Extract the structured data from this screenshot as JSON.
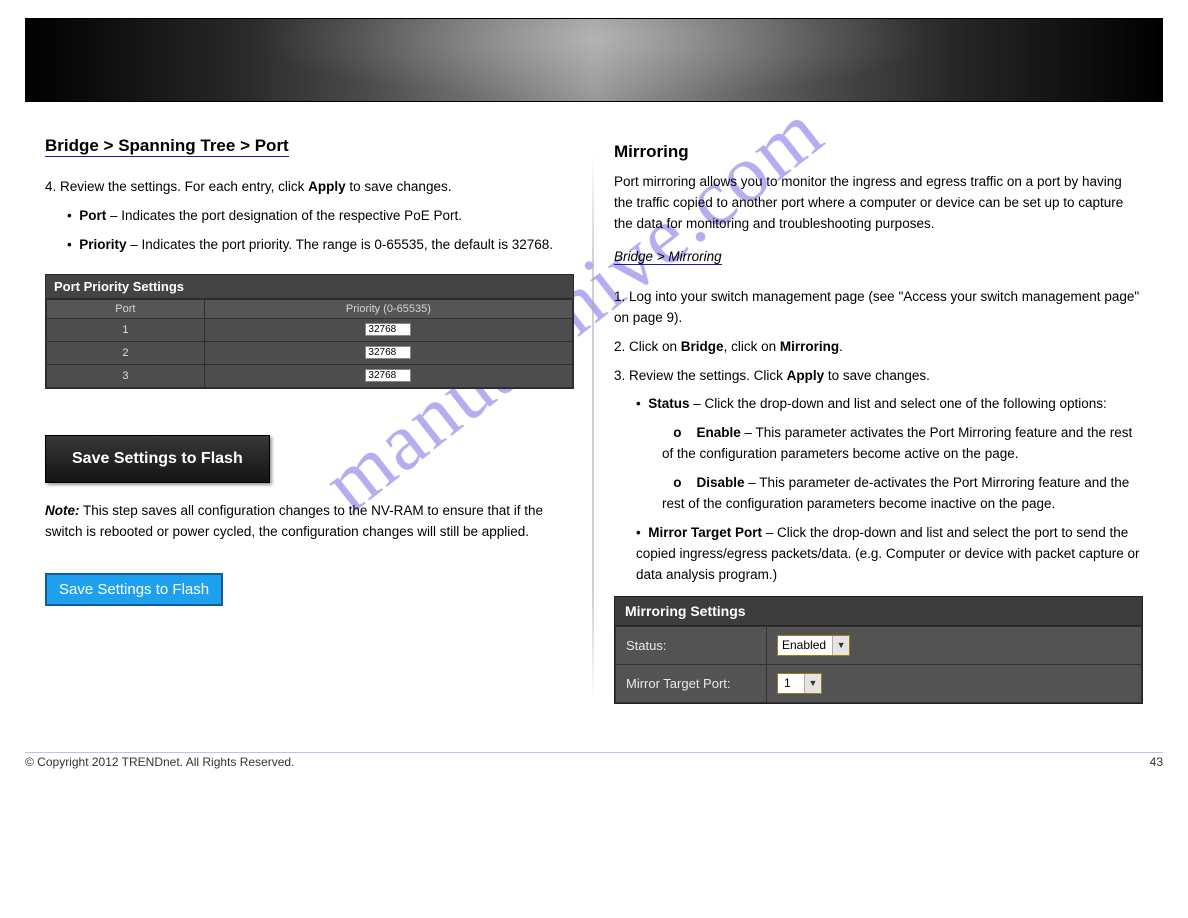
{
  "header": {
    "copyright": "© Copyright 2012 TRENDnet. All Rights Reserved.",
    "page_num": "43"
  },
  "left": {
    "bridge_title": "Bridge > Spanning Tree > Port",
    "intro_line1_prefix": "4.",
    "intro_line1_body": " Review the settings. For each entry, click ",
    "intro_line1_apply": "Apply",
    "intro_line1_tail": " to save changes.",
    "bullet_port_label": "Port ",
    "bullet_port_body": "– Indicates the port designation of the respective PoE Port.",
    "bullet_prio_label": "Priority ",
    "bullet_prio_body": "–  Indicates the port priority. The range is 0-65535, the default is 32768.",
    "pp_table_title": "Port Priority Settings",
    "pp_col_port": "Port",
    "pp_col_prio": "Priority (0-65535)",
    "pp_rows": [
      {
        "port": "1",
        "value": "32768"
      },
      {
        "port": "2",
        "value": "32768"
      },
      {
        "port": "3",
        "value": "32768"
      }
    ],
    "save_dark": "Save Settings to Flash",
    "save_note_bold": "Note:",
    "save_note_body": " This step saves all configuration changes to the NV-RAM to ensure that if the switch is rebooted or power cycled, the configuration changes will still be applied.",
    "save_blue": "Save Settings to Flash"
  },
  "right": {
    "mirror_title": "Mirroring",
    "mirror_desc": "Port mirroring allows you to monitor the ingress and egress traffic on a port by having the traffic copied to another port where a computer or device can be set up to capture the data for monitoring and troubleshooting purposes.",
    "mirror_link_text": "Bridge > Mirroring",
    "step1_num": "1.",
    "step1_body": " Log into your switch management page (see ",
    "step1_linkish": "\"Access your switch management page\"",
    "step1_tail": " on page 9).",
    "step2_num": "2.",
    "step2_pre": " Click on ",
    "step2_b": "Bridge",
    "step2_mid": ", click on ",
    "step2_m": "Mirroring",
    "step2_end": ".",
    "step3_num": "3.",
    "step3_body": " Review the settings. Click ",
    "step3_apply": "Apply",
    "step3_tail": " to save changes.",
    "bullet_status_label": "Status ",
    "bullet_status_body": "– Click the drop-down and list and select one of the following options:",
    "sub_enable_label": "   o    Enable ",
    "sub_enable_body": "– This parameter activates the Port Mirroring feature and the rest of the configuration parameters become active on the page.",
    "sub_disable_label": "   o    Disable ",
    "sub_disable_body": "– This parameter de-activates the Port Mirroring feature and the rest of the configuration parameters become inactive on the page.",
    "bullet_mtp_label": "Mirror Target Port ",
    "bullet_mtp_body": "– Click the drop-down and list and select the port to send the copied ingress/egress packets/data. (e.g. Computer or device with packet capture or data analysis program.)",
    "ms_title": "Mirroring Settings",
    "ms_status_label": "Status:",
    "ms_status_value": "Enabled",
    "ms_target_label": "Mirror Target Port:",
    "ms_target_value": "1"
  },
  "watermark": "manualshive.com"
}
